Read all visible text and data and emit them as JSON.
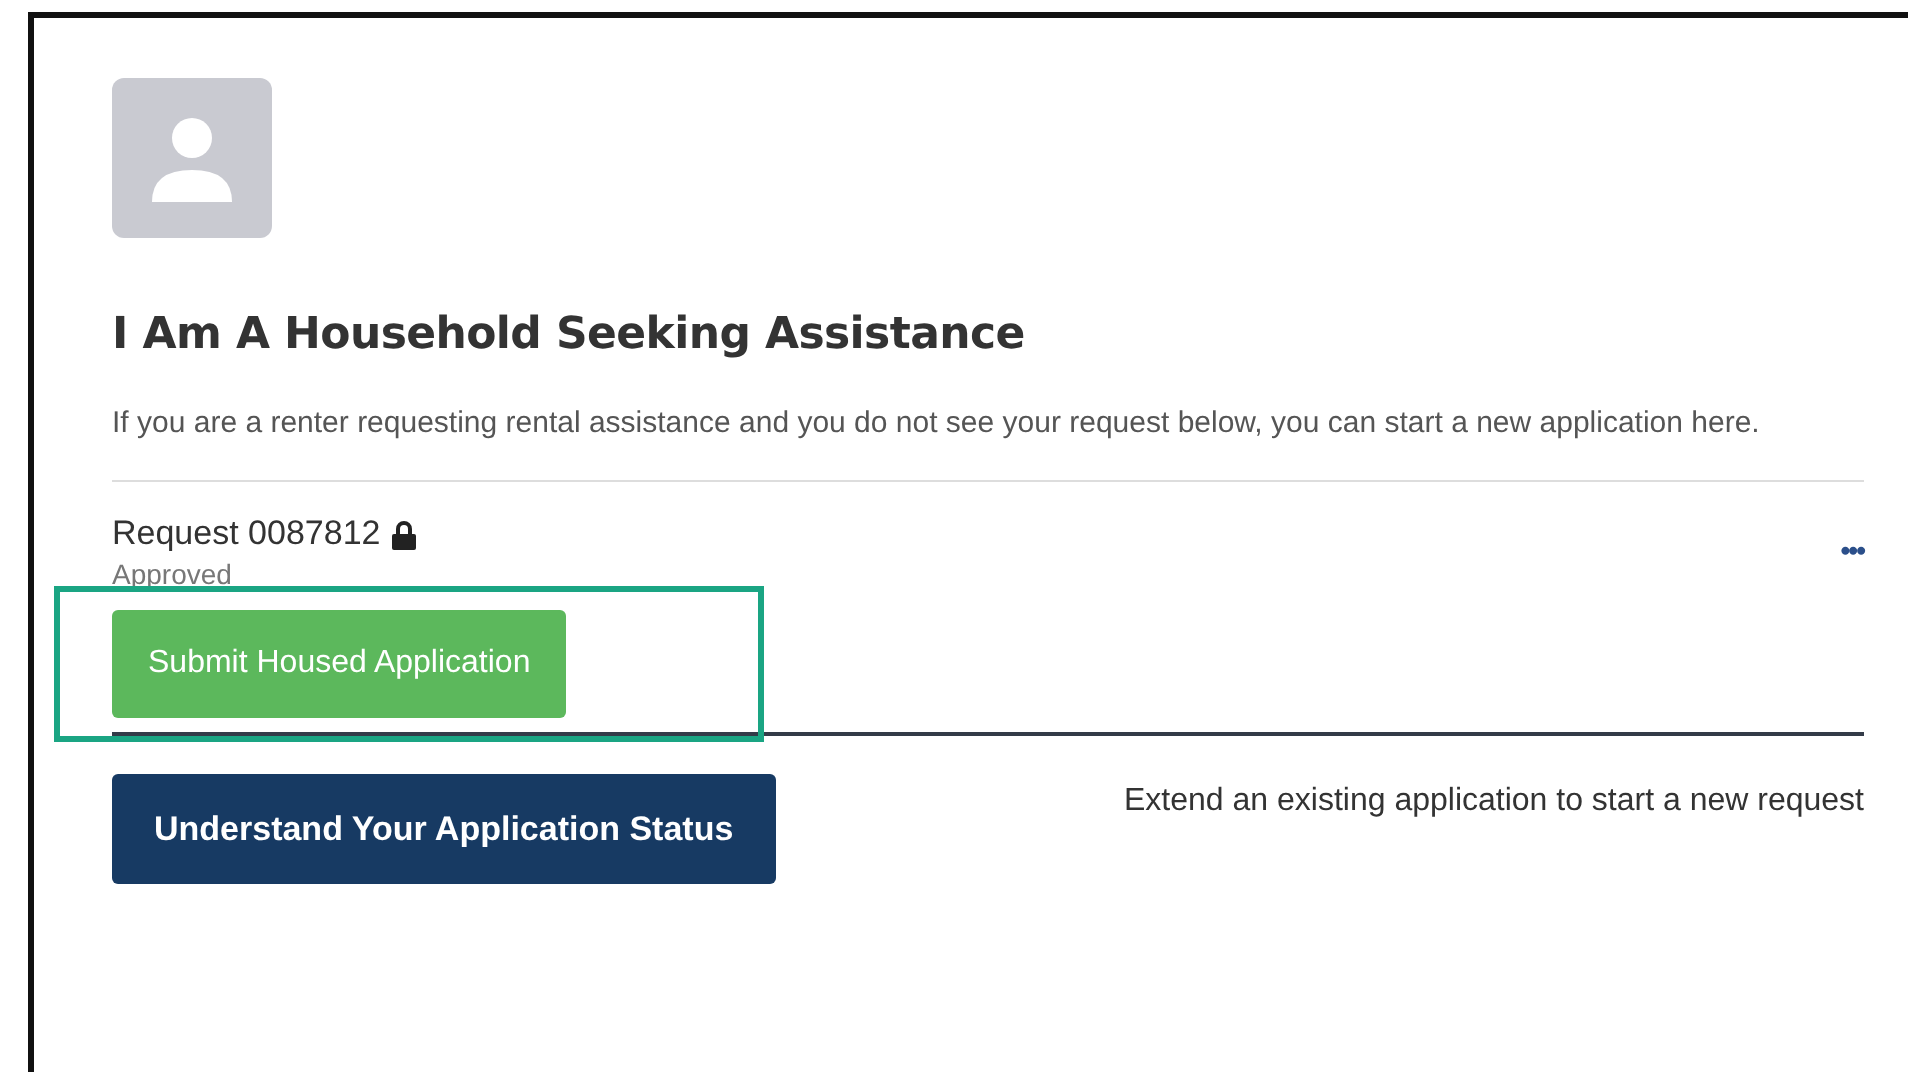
{
  "heading": "I Am A Household Seeking Assistance",
  "description": "If you are a renter requesting rental assistance and you do not see your request below, you can start a new application here.",
  "request": {
    "title": "Request 0087812",
    "locked": true,
    "status": "Approved",
    "menu": "•••",
    "action": "Submit Housed Application",
    "highlighted": true
  },
  "footer": {
    "button": "Understand Your Application Status",
    "note": "Extend an existing application to start a new request"
  }
}
